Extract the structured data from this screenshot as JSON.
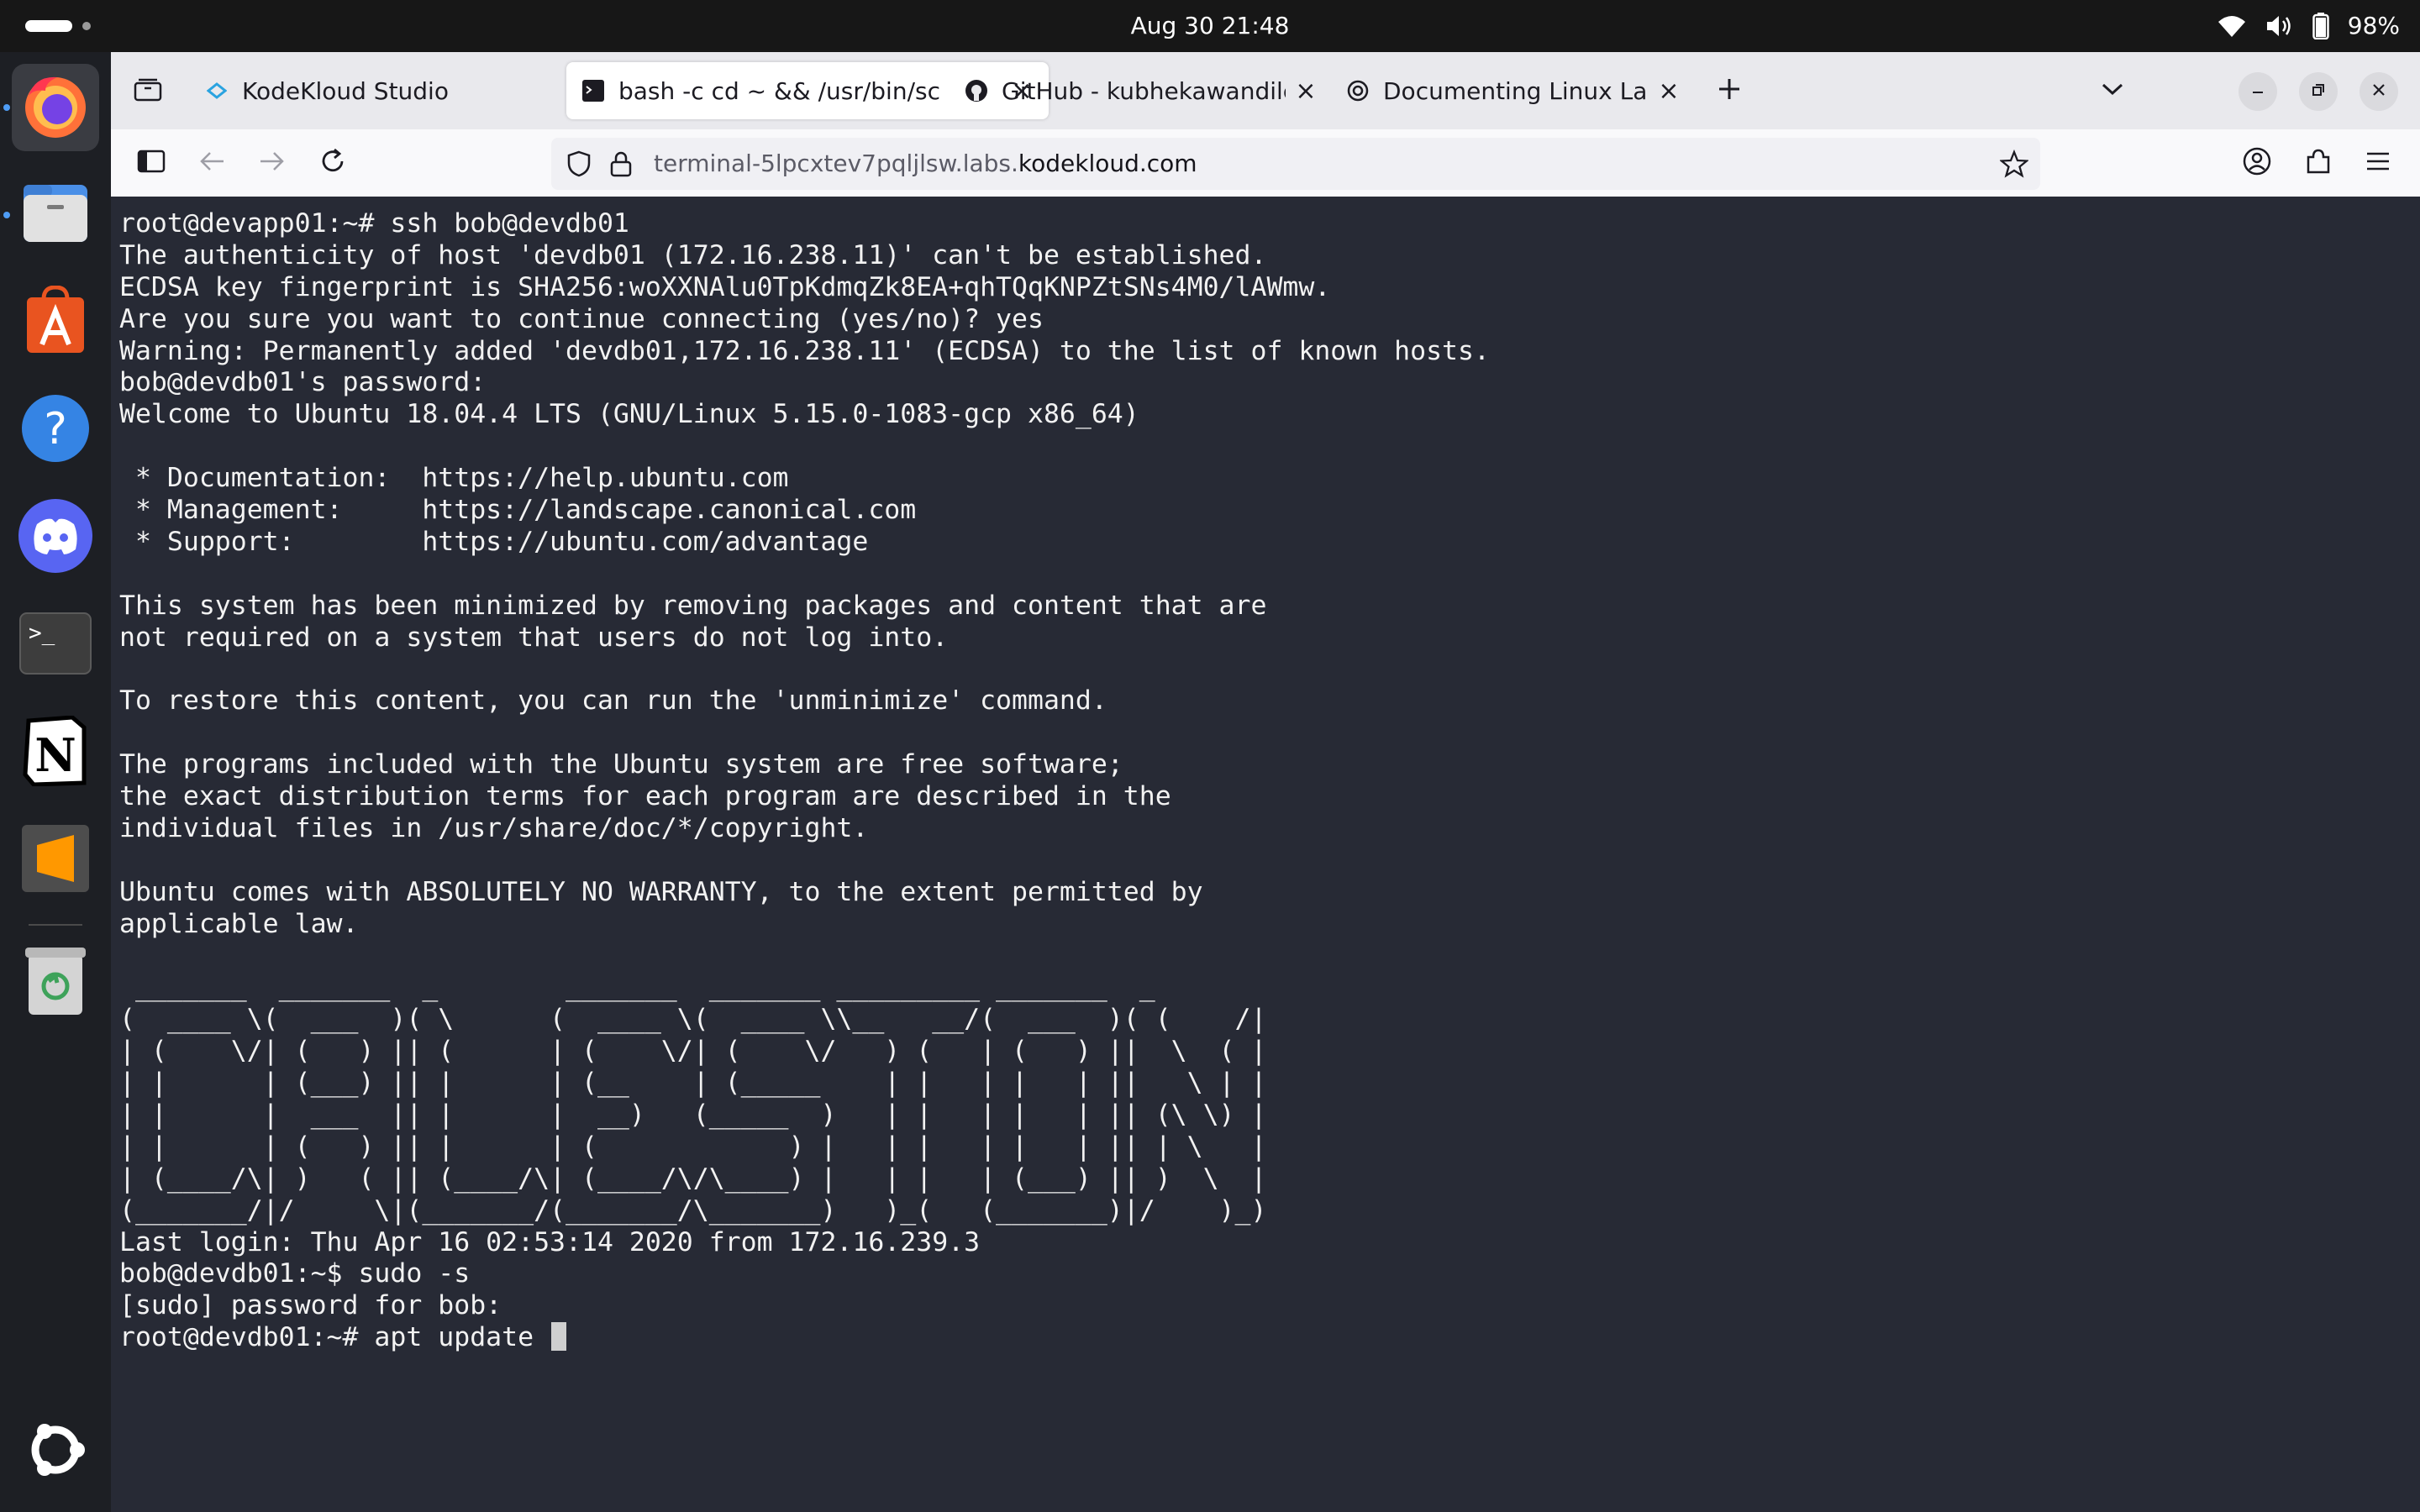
{
  "topbar": {
    "clock": "Aug 30  21:48",
    "battery_percent": "98%",
    "icons": [
      "wifi-icon",
      "volume-icon",
      "battery-icon"
    ]
  },
  "dock": {
    "items": [
      {
        "name": "firefox",
        "icon": "firefox-icon",
        "active": true
      },
      {
        "name": "files",
        "icon": "files-icon",
        "active": false
      },
      {
        "name": "app-center",
        "icon": "app-center-icon",
        "active": false
      },
      {
        "name": "help",
        "icon": "help-icon",
        "active": false
      },
      {
        "name": "discord",
        "icon": "discord-icon",
        "active": false
      },
      {
        "name": "terminal",
        "icon": "terminal-icon",
        "active": false
      },
      {
        "name": "notion",
        "icon": "notion-icon",
        "active": false
      },
      {
        "name": "sublime-text",
        "icon": "sublime-icon",
        "active": false
      },
      {
        "name": "trash",
        "icon": "trash-icon",
        "active": false
      },
      {
        "name": "show-apps",
        "icon": "ubuntu-icon",
        "active": false
      }
    ]
  },
  "browser": {
    "tabs": [
      {
        "title": "KodeKloud Studio",
        "icon": "kodekloud-icon",
        "active": false
      },
      {
        "title": "bash -c cd ~ && /usr/bin/sc",
        "icon": "terminal-tab-icon",
        "active": true
      },
      {
        "title": "GitHub - kubhekawandile/",
        "icon": "github-icon",
        "active": false
      },
      {
        "title": "Documenting Linux Labs",
        "icon": "chatgpt-icon",
        "active": false
      }
    ],
    "url_prefix": "terminal-5lpcxtev7pqljlsw.labs.",
    "url_domain": "kodekloud.com"
  },
  "terminal": {
    "lines": [
      "root@devapp01:~# ssh bob@devdb01",
      "The authenticity of host 'devdb01 (172.16.238.11)' can't be established.",
      "ECDSA key fingerprint is SHA256:woXXNAlu0TpKdmqZk8EA+qhTQqKNPZtSNs4M0/lAWmw.",
      "Are you sure you want to continue connecting (yes/no)? yes",
      "Warning: Permanently added 'devdb01,172.16.238.11' (ECDSA) to the list of known hosts.",
      "bob@devdb01's password:",
      "Welcome to Ubuntu 18.04.4 LTS (GNU/Linux 5.15.0-1083-gcp x86_64)",
      "",
      " * Documentation:  https://help.ubuntu.com",
      " * Management:     https://landscape.canonical.com",
      " * Support:        https://ubuntu.com/advantage",
      "",
      "This system has been minimized by removing packages and content that are",
      "not required on a system that users do not log into.",
      "",
      "To restore this content, you can run the 'unminimize' command.",
      "",
      "The programs included with the Ubuntu system are free software;",
      "the exact distribution terms for each program are described in the",
      "individual files in /usr/share/doc/*/copyright.",
      "",
      "Ubuntu comes with ABSOLUTELY NO WARRANTY, to the extent permitted by",
      "applicable law.",
      "",
      " _______  _______  _        _______  _______ _________ _______  _",
      "(  ____ \\(  ___  )( \\      (  ____ \\(  ____ \\\\__   __/(  ___  )( (    /|",
      "| (    \\/| (   ) || (      | (    \\/| (    \\/   ) (   | (   ) ||  \\  ( |",
      "| |      | (___) || |      | (__    | (_____    | |   | |   | ||   \\ | |",
      "| |      |  ___  || |      |  __)   (_____  )   | |   | |   | || (\\ \\) |",
      "| |      | (   ) || |      | (            ) |   | |   | |   | || | \\   |",
      "| (____/\\| )   ( || (____/\\| (____/\\/\\____) |   | |   | (___) || )  \\  |",
      "(_______/|/     \\|(_______/(_______/\\_______)   )_(   (_______)|/    )_)",
      "Last login: Thu Apr 16 02:53:14 2020 from 172.16.239.3",
      "bob@devdb01:~$ sudo -s",
      "[sudo] password for bob:",
      "root@devdb01:~# apt update "
    ]
  },
  "colors": {
    "terminal_bg": "#272a35",
    "terminal_fg": "#f2f2f2",
    "tabbar_bg": "#e9e9ed",
    "topbar_bg": "#171717",
    "dock_bg": "#1d1f24"
  }
}
